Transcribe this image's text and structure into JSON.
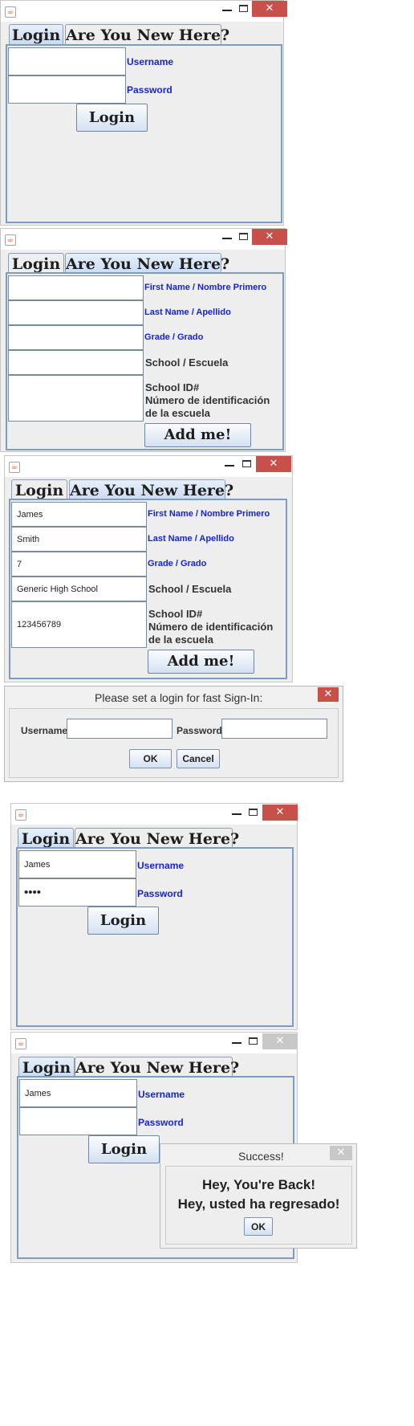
{
  "tabs": {
    "login": "Login",
    "new_here": "Are You New Here?"
  },
  "window_controls": {
    "minimize": "–",
    "maximize": "□",
    "close": "✕"
  },
  "java_icon": "java-cup-icon",
  "login_form": {
    "username_label": "Username",
    "password_label": "Password",
    "login_button": "Login"
  },
  "register_form": {
    "first_name_label": "First Name / Nombre Primero",
    "last_name_label": "Last Name / Apellido",
    "grade_label": "Grade / Grado",
    "school_label": "School / Escuela",
    "school_id_label_1": "School ID#",
    "school_id_label_2": "Número de identificación",
    "school_id_label_3": "de la escuela",
    "add_button": "Add me!"
  },
  "register_filled": {
    "first_name": "James",
    "last_name": "Smith",
    "grade": "7",
    "school": "Generic High School",
    "school_id": "123456789"
  },
  "set_login_dialog": {
    "title": "Please set a login for fast Sign-In:",
    "username_label": "Username",
    "password_label": "Password",
    "ok": "OK",
    "cancel": "Cancel"
  },
  "login_filled": {
    "username": "James",
    "password_mask": "••••"
  },
  "success_dialog": {
    "title": "Success!",
    "line1": "Hey, You're Back!",
    "line2": "Hey, usted ha regresado!",
    "ok": "OK"
  },
  "colors": {
    "title_close": "#c7504a",
    "label_blue": "#1624d6",
    "panel_border": "#7e9cc1"
  }
}
